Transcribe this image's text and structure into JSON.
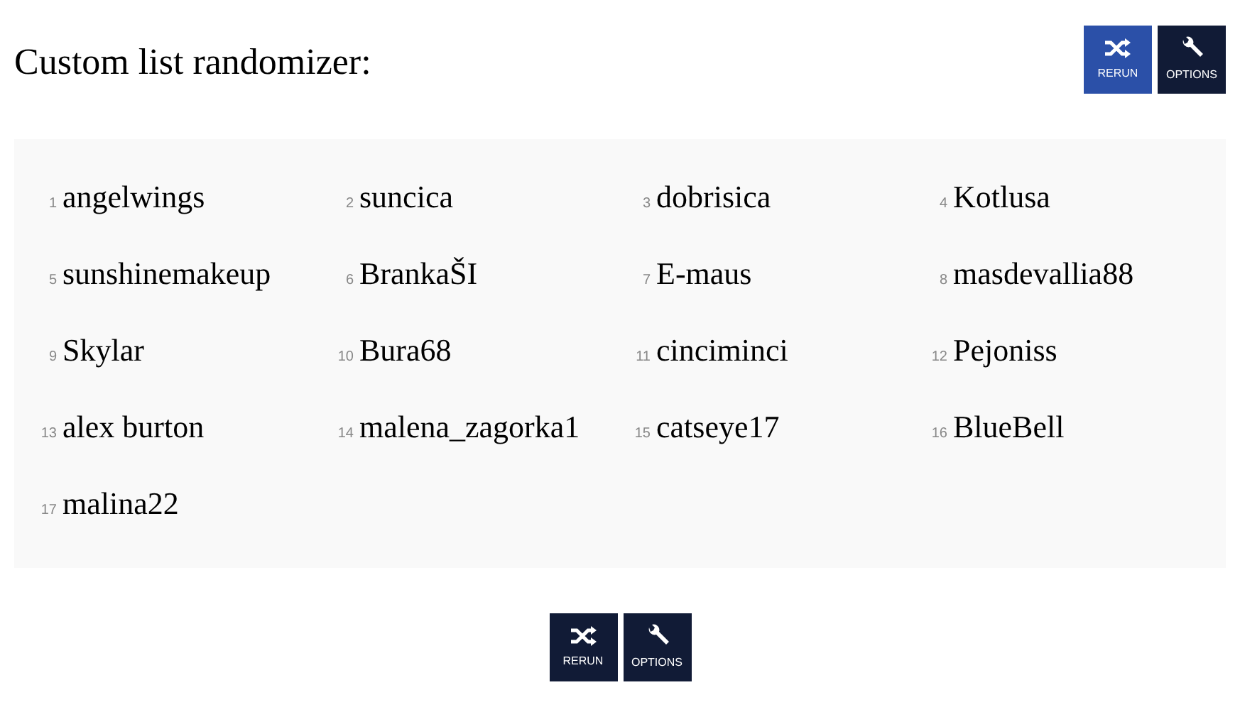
{
  "title": "Custom list randomizer:",
  "top_buttons": [
    {
      "kind": "rerun",
      "label": "RERUN",
      "highlighted": true
    },
    {
      "kind": "options",
      "label": "OPTIONS",
      "highlighted": false
    }
  ],
  "items": [
    {
      "number": "1",
      "name": "angelwings"
    },
    {
      "number": "2",
      "name": "suncica"
    },
    {
      "number": "3",
      "name": "dobrisica"
    },
    {
      "number": "4",
      "name": "Kotlusa"
    },
    {
      "number": "5",
      "name": "sunshinemakeup"
    },
    {
      "number": "6",
      "name": "BrankaŠI"
    },
    {
      "number": "7",
      "name": "E-maus"
    },
    {
      "number": "8",
      "name": "masdevallia88"
    },
    {
      "number": "9",
      "name": "Skylar"
    },
    {
      "number": "10",
      "name": "Bura68"
    },
    {
      "number": "11",
      "name": "cinciminci"
    },
    {
      "number": "12",
      "name": "Pejoniss"
    },
    {
      "number": "13",
      "name": "alex burton"
    },
    {
      "number": "14",
      "name": "malena_zagorka1"
    },
    {
      "number": "15",
      "name": "catseye17"
    },
    {
      "number": "16",
      "name": "BlueBell"
    },
    {
      "number": "17",
      "name": "malina22"
    }
  ],
  "bottom_buttons": [
    {
      "kind": "rerun",
      "label": "RERUN",
      "highlighted": false
    },
    {
      "kind": "options",
      "label": "OPTIONS",
      "highlighted": false
    }
  ]
}
